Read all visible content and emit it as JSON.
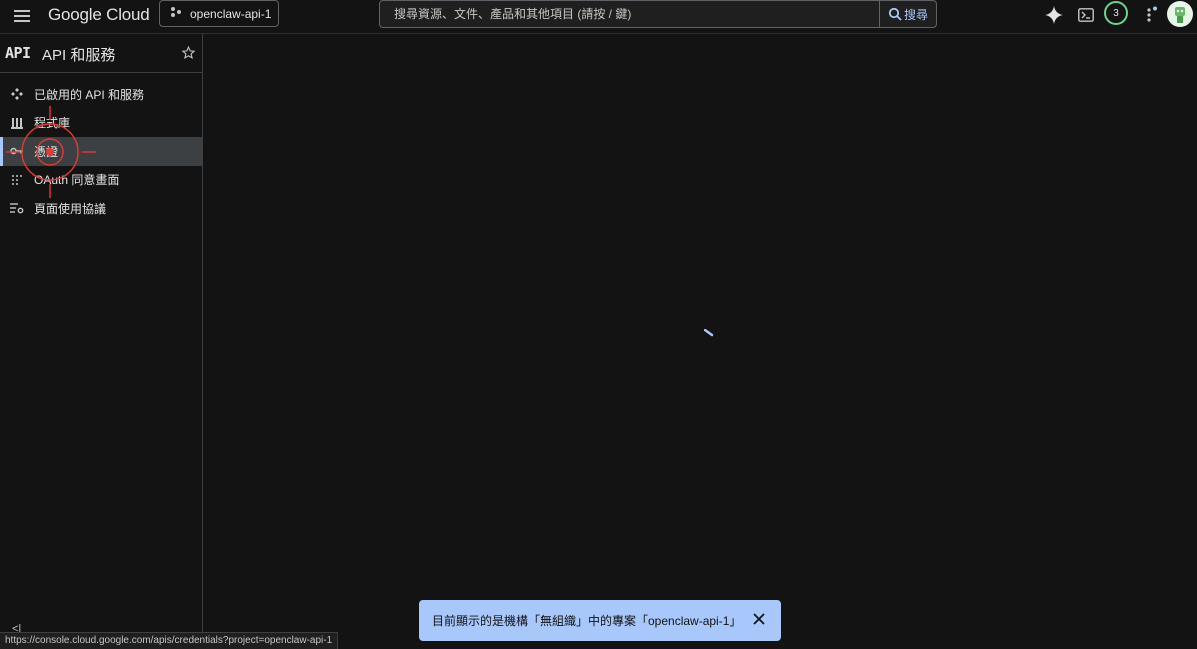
{
  "header": {
    "logo": "Google Cloud",
    "project": "openclaw-api-1",
    "search_placeholder": "搜尋資源、文件、產品和其他項目 (請按 / 鍵)",
    "search_button": "搜尋",
    "notification_count": "3"
  },
  "sidebar": {
    "logo": "API",
    "title": "API 和服務",
    "items": [
      {
        "label": "已啟用的 API 和服務",
        "icon": "api-diamond-icon"
      },
      {
        "label": "程式庫",
        "icon": "library-icon"
      },
      {
        "label": "憑證",
        "icon": "key-icon",
        "active": true
      },
      {
        "label": "OAuth 同意畫面",
        "icon": "oauth-dots-icon"
      },
      {
        "label": "頁面使用協議",
        "icon": "page-settings-icon"
      }
    ],
    "collapse_label": "<|"
  },
  "toast": {
    "message": "目前顯示的是機構「無組織」中的專案「openclaw-api-1」"
  },
  "status_url": "https://console.cloud.google.com/apis/credentials?project=openclaw-api-1",
  "colors": {
    "background": "#131314",
    "accent": "#a8c7fa",
    "active_item": "#3c4043",
    "badge_ring": "#6dd58c",
    "click_marker": "#e53935"
  }
}
